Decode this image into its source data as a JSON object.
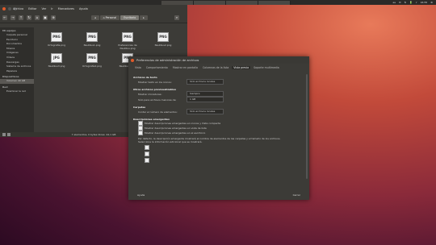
{
  "topbar": {
    "tabs": [
      "",
      "",
      "",
      ""
    ],
    "tray": [
      "es",
      "✉",
      "⇅",
      "🔋",
      "♪",
      "16:55",
      "⚙"
    ]
  },
  "file_manager": {
    "menus": [
      "Archivo",
      "Editar",
      "Ver",
      "Ir",
      "Marcadores",
      "Ayuda"
    ],
    "breadcrumb": [
      "◂",
      "⌂ Personal",
      "Escritorio",
      "▸"
    ],
    "sidebar": {
      "sections": [
        {
          "title": "Mi equipo",
          "items": [
            "Carpeta personal",
            "Escritorio",
            "Documentos",
            "Música",
            "Imágenes",
            "Vídeos",
            "Descargas",
            "Sistema de archivos",
            "Papelera"
          ]
        },
        {
          "title": "Dispositivos",
          "items": [
            "Volumen 40 GB"
          ]
        },
        {
          "title": "Red",
          "items": [
            "Examinar la red"
          ]
        }
      ]
    },
    "files": [
      {
        "name": "Ortografía.png",
        "type": "PNG"
      },
      {
        "name": "Nautilus1.png",
        "type": "PNG"
      },
      {
        "name": "Preferencias de Nautilus.png",
        "type": "PNG"
      },
      {
        "name": "Nautilus2.png",
        "type": "PNG"
      },
      {
        "name": "Nautilus3.png",
        "type": "JPG"
      },
      {
        "name": "Ortografía2.png",
        "type": "PNG"
      },
      {
        "name": "Nautilus4.png",
        "type": "PNG"
      }
    ],
    "status": "7 elementos, 0 bytes libres: 44,1 GB"
  },
  "dialog": {
    "title": "Preferencias de administración de archivos",
    "tabs": [
      "Vista",
      "Comportamiento",
      "Mostrar en pantalla",
      "Columnas de la lista",
      "Vista previa",
      "Soporte multimedia"
    ],
    "active_tab": "Vista previa",
    "sections": {
      "text": {
        "heading": "Archivos de texto",
        "label": "Mostrar texto en los iconos:",
        "value": "Sólo archivos locales"
      },
      "other": {
        "heading": "Otros archivos previsualizables",
        "label1": "Mostrar miniaturas:",
        "value1": "Siempre",
        "label2": "Sólo para archivos menores de:",
        "value2": "1 GB"
      },
      "folders": {
        "heading": "Carpetas",
        "label": "Contar el número de elementos:",
        "value": "Sólo archivos locales"
      },
      "tooltips": {
        "heading": "Descripciones emergentes",
        "checks": [
          "Mostrar descripciones emergentes en iconos y Vista compacta",
          "Mostrar descripciones emergentes en vista de lista",
          "Mostrar descripciones emergentes en el escritorio"
        ],
        "note": "Por defecto, la descripción emergente mostrará el nombre de elementos de las carpetas y el tamaño de los archivos. Seleccione la información adicional que se mostrará."
      }
    },
    "help": "Ayuda",
    "close": "Cerrar"
  }
}
